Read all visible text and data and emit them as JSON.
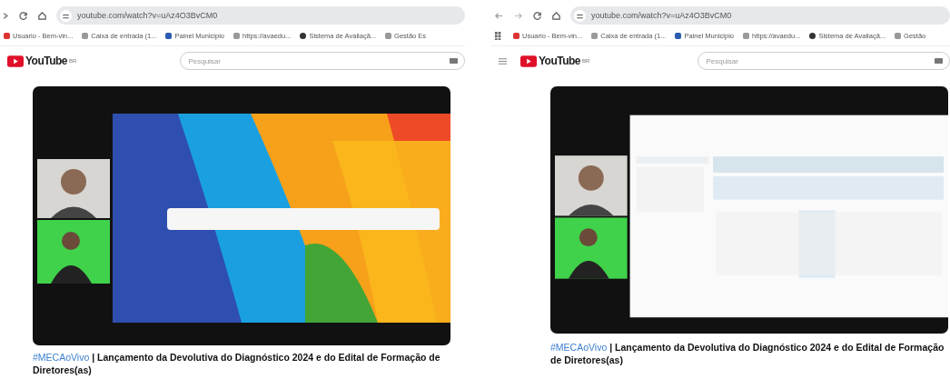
{
  "panels": [
    {
      "kind": "cropped",
      "url": "youtube.com/watch?v=uAz4O3BvCM0",
      "bookmarks": [
        "Usuario - Bem-vin...",
        "Caixa de entrada (1...",
        "Painel Municipio",
        "https://avaedu...",
        "Sistema de Avaliaçã...",
        "Gestão Es"
      ],
      "logo": "YouTube",
      "logo_region": "BR",
      "search": {
        "placeholder": "Pesquisar"
      },
      "hashtag": "#MECAoVivo",
      "title": "| Lançamento da Devolutiva do Diagnóstico 2024 e do Edital de Formação de Diretores(as)"
    },
    {
      "kind": "full",
      "url": "youtube.com/watch?v=uAz4O3BvCM0",
      "bookmarks": [
        "Usuario - Bem-vin...",
        "Caixa de entrada (1...",
        "Painel Municipio",
        "https://avaedu...",
        "Sistema de Avaliaçã...",
        "Gestão"
      ],
      "logo": "YouTube",
      "logo_region": "BR",
      "search": {
        "placeholder": "Pesquisar"
      },
      "hashtag": "#MECAoVivo",
      "title": "| Lançamento da Devolutiva do Diagnóstico 2024 e do Edital de Formação de Diretores(as)"
    }
  ]
}
